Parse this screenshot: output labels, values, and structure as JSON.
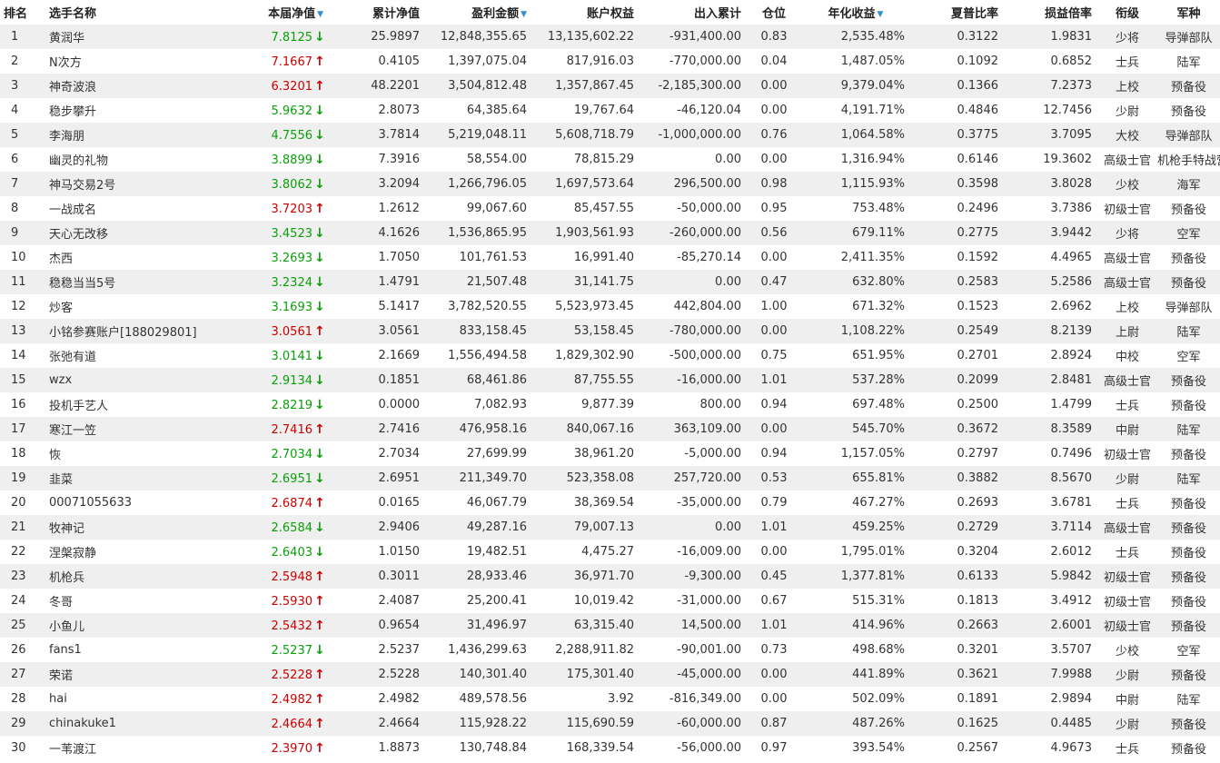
{
  "columns": {
    "rank": "排名",
    "name": "选手名称",
    "net_value": "本届净值",
    "cumulative_net": "累计净值",
    "profit": "盈利金额",
    "equity": "账户权益",
    "in_out": "出入累计",
    "position": "仓位",
    "annualized": "年化收益",
    "sharpe": "夏普比率",
    "pl_ratio": "损益倍率",
    "military_rank": "衔级",
    "branch": "军种"
  },
  "sort_icon": "triangle-down-icon",
  "colors": {
    "up": "#cc0000",
    "down": "#0aa00a",
    "sort_icon": "#2f8fd1",
    "row_alt": "#efefef"
  },
  "rows": [
    {
      "rank": "1",
      "name": "黄润华",
      "net": "7.8125",
      "dir": "down",
      "cum": "25.9897",
      "pnl": "12,848,355.65",
      "equity": "13,135,602.22",
      "io": "-931,400.00",
      "pos": "0.83",
      "ann": "2,535.48%",
      "sharpe": "0.3122",
      "ratio": "1.9831",
      "mrank": "少将",
      "branch": "导弹部队"
    },
    {
      "rank": "2",
      "name": "N次方",
      "net": "7.1667",
      "dir": "up",
      "cum": "0.4105",
      "pnl": "1,397,075.04",
      "equity": "817,916.03",
      "io": "-770,000.00",
      "pos": "0.04",
      "ann": "1,487.05%",
      "sharpe": "0.1092",
      "ratio": "0.6852",
      "mrank": "士兵",
      "branch": "陆军"
    },
    {
      "rank": "3",
      "name": "神奇波浪",
      "net": "6.3201",
      "dir": "up",
      "cum": "48.2201",
      "pnl": "3,504,812.48",
      "equity": "1,357,867.45",
      "io": "-2,185,300.00",
      "pos": "0.00",
      "ann": "9,379.04%",
      "sharpe": "0.1366",
      "ratio": "7.2373",
      "mrank": "上校",
      "branch": "预备役"
    },
    {
      "rank": "4",
      "name": "稳步攀升",
      "net": "5.9632",
      "dir": "down",
      "cum": "2.8073",
      "pnl": "64,385.64",
      "equity": "19,767.64",
      "io": "-46,120.04",
      "pos": "0.00",
      "ann": "4,191.71%",
      "sharpe": "0.4846",
      "ratio": "12.7456",
      "mrank": "少尉",
      "branch": "预备役"
    },
    {
      "rank": "5",
      "name": "李海朋",
      "net": "4.7556",
      "dir": "down",
      "cum": "3.7814",
      "pnl": "5,219,048.11",
      "equity": "5,608,718.79",
      "io": "-1,000,000.00",
      "pos": "0.76",
      "ann": "1,064.58%",
      "sharpe": "0.3775",
      "ratio": "3.7095",
      "mrank": "大校",
      "branch": "导弹部队"
    },
    {
      "rank": "6",
      "name": "幽灵的礼物",
      "net": "3.8899",
      "dir": "down",
      "cum": "7.3916",
      "pnl": "58,554.00",
      "equity": "78,815.29",
      "io": "0.00",
      "pos": "0.00",
      "ann": "1,316.94%",
      "sharpe": "0.6146",
      "ratio": "19.3602",
      "mrank": "高级士官",
      "branch": "机枪手特战营"
    },
    {
      "rank": "7",
      "name": "神马交易2号",
      "net": "3.8062",
      "dir": "down",
      "cum": "3.2094",
      "pnl": "1,266,796.05",
      "equity": "1,697,573.64",
      "io": "296,500.00",
      "pos": "0.98",
      "ann": "1,115.93%",
      "sharpe": "0.3598",
      "ratio": "3.8028",
      "mrank": "少校",
      "branch": "海军"
    },
    {
      "rank": "8",
      "name": "一战成名",
      "net": "3.7203",
      "dir": "up",
      "cum": "1.2612",
      "pnl": "99,067.60",
      "equity": "85,457.55",
      "io": "-50,000.00",
      "pos": "0.95",
      "ann": "753.48%",
      "sharpe": "0.2496",
      "ratio": "3.7386",
      "mrank": "初级士官",
      "branch": "预备役"
    },
    {
      "rank": "9",
      "name": "天心无改移",
      "net": "3.4523",
      "dir": "down",
      "cum": "4.1626",
      "pnl": "1,536,865.95",
      "equity": "1,903,561.93",
      "io": "-260,000.00",
      "pos": "0.56",
      "ann": "679.11%",
      "sharpe": "0.2775",
      "ratio": "3.9442",
      "mrank": "少将",
      "branch": "空军"
    },
    {
      "rank": "10",
      "name": "杰西",
      "net": "3.2693",
      "dir": "down",
      "cum": "1.7050",
      "pnl": "101,761.53",
      "equity": "16,991.40",
      "io": "-85,270.14",
      "pos": "0.00",
      "ann": "2,411.35%",
      "sharpe": "0.1592",
      "ratio": "4.4965",
      "mrank": "高级士官",
      "branch": "预备役"
    },
    {
      "rank": "11",
      "name": "稳稳当当5号",
      "net": "3.2324",
      "dir": "down",
      "cum": "1.4791",
      "pnl": "21,507.48",
      "equity": "31,141.75",
      "io": "0.00",
      "pos": "0.47",
      "ann": "632.80%",
      "sharpe": "0.2583",
      "ratio": "5.2586",
      "mrank": "高级士官",
      "branch": "预备役"
    },
    {
      "rank": "12",
      "name": "炒客",
      "net": "3.1693",
      "dir": "down",
      "cum": "5.1417",
      "pnl": "3,782,520.55",
      "equity": "5,523,973.45",
      "io": "442,804.00",
      "pos": "1.00",
      "ann": "671.32%",
      "sharpe": "0.1523",
      "ratio": "2.6962",
      "mrank": "上校",
      "branch": "导弹部队"
    },
    {
      "rank": "13",
      "name": "小铭参赛账户[188029801]",
      "net": "3.0561",
      "dir": "up",
      "cum": "3.0561",
      "pnl": "833,158.45",
      "equity": "53,158.45",
      "io": "-780,000.00",
      "pos": "0.00",
      "ann": "1,108.22%",
      "sharpe": "0.2549",
      "ratio": "8.2139",
      "mrank": "上尉",
      "branch": "陆军"
    },
    {
      "rank": "14",
      "name": "张弛有道",
      "net": "3.0141",
      "dir": "down",
      "cum": "2.1669",
      "pnl": "1,556,494.58",
      "equity": "1,829,302.90",
      "io": "-500,000.00",
      "pos": "0.75",
      "ann": "651.95%",
      "sharpe": "0.2701",
      "ratio": "2.8924",
      "mrank": "中校",
      "branch": "空军"
    },
    {
      "rank": "15",
      "name": "wzx",
      "net": "2.9134",
      "dir": "down",
      "cum": "0.1851",
      "pnl": "68,461.86",
      "equity": "87,755.55",
      "io": "-16,000.00",
      "pos": "1.01",
      "ann": "537.28%",
      "sharpe": "0.2099",
      "ratio": "2.8481",
      "mrank": "高级士官",
      "branch": "预备役"
    },
    {
      "rank": "16",
      "name": "投机手艺人",
      "net": "2.8219",
      "dir": "down",
      "cum": "0.0000",
      "pnl": "7,082.93",
      "equity": "9,877.39",
      "io": "800.00",
      "pos": "0.94",
      "ann": "697.48%",
      "sharpe": "0.2500",
      "ratio": "1.4799",
      "mrank": "士兵",
      "branch": "预备役"
    },
    {
      "rank": "17",
      "name": "寒江一笠",
      "net": "2.7416",
      "dir": "up",
      "cum": "2.7416",
      "pnl": "476,958.16",
      "equity": "840,067.16",
      "io": "363,109.00",
      "pos": "0.00",
      "ann": "545.70%",
      "sharpe": "0.3672",
      "ratio": "8.3589",
      "mrank": "中尉",
      "branch": "陆军"
    },
    {
      "rank": "18",
      "name": "恢",
      "net": "2.7034",
      "dir": "down",
      "cum": "2.7034",
      "pnl": "27,699.99",
      "equity": "38,961.20",
      "io": "-5,000.00",
      "pos": "0.94",
      "ann": "1,157.05%",
      "sharpe": "0.2797",
      "ratio": "0.7496",
      "mrank": "初级士官",
      "branch": "预备役"
    },
    {
      "rank": "19",
      "name": "韭菜",
      "net": "2.6951",
      "dir": "down",
      "cum": "2.6951",
      "pnl": "211,349.70",
      "equity": "523,358.08",
      "io": "257,720.00",
      "pos": "0.53",
      "ann": "655.81%",
      "sharpe": "0.3882",
      "ratio": "8.5670",
      "mrank": "少尉",
      "branch": "陆军"
    },
    {
      "rank": "20",
      "name": "00071055633",
      "net": "2.6874",
      "dir": "up",
      "cum": "0.0165",
      "pnl": "46,067.79",
      "equity": "38,369.54",
      "io": "-35,000.00",
      "pos": "0.79",
      "ann": "467.27%",
      "sharpe": "0.2693",
      "ratio": "3.6781",
      "mrank": "士兵",
      "branch": "预备役"
    },
    {
      "rank": "21",
      "name": "牧神记",
      "net": "2.6584",
      "dir": "down",
      "cum": "2.9406",
      "pnl": "49,287.16",
      "equity": "79,007.13",
      "io": "0.00",
      "pos": "1.01",
      "ann": "459.25%",
      "sharpe": "0.2729",
      "ratio": "3.7114",
      "mrank": "高级士官",
      "branch": "预备役"
    },
    {
      "rank": "22",
      "name": "涅槃寂静",
      "net": "2.6403",
      "dir": "down",
      "cum": "1.0150",
      "pnl": "19,482.51",
      "equity": "4,475.27",
      "io": "-16,009.00",
      "pos": "0.00",
      "ann": "1,795.01%",
      "sharpe": "0.3204",
      "ratio": "2.6012",
      "mrank": "士兵",
      "branch": "预备役"
    },
    {
      "rank": "23",
      "name": "机枪兵",
      "net": "2.5948",
      "dir": "up",
      "cum": "0.3011",
      "pnl": "28,933.46",
      "equity": "36,971.70",
      "io": "-9,300.00",
      "pos": "0.45",
      "ann": "1,377.81%",
      "sharpe": "0.6133",
      "ratio": "5.9842",
      "mrank": "初级士官",
      "branch": "预备役"
    },
    {
      "rank": "24",
      "name": "冬哥",
      "net": "2.5930",
      "dir": "up",
      "cum": "2.4087",
      "pnl": "25,200.41",
      "equity": "10,019.42",
      "io": "-31,000.00",
      "pos": "0.67",
      "ann": "515.31%",
      "sharpe": "0.1813",
      "ratio": "3.4912",
      "mrank": "初级士官",
      "branch": "预备役"
    },
    {
      "rank": "25",
      "name": "小鱼儿",
      "net": "2.5432",
      "dir": "up",
      "cum": "0.9654",
      "pnl": "31,496.97",
      "equity": "63,315.40",
      "io": "14,500.00",
      "pos": "1.01",
      "ann": "414.96%",
      "sharpe": "0.2663",
      "ratio": "2.6001",
      "mrank": "初级士官",
      "branch": "预备役"
    },
    {
      "rank": "26",
      "name": "fans1",
      "net": "2.5237",
      "dir": "down",
      "cum": "2.5237",
      "pnl": "1,436,299.63",
      "equity": "2,288,911.82",
      "io": "-90,001.00",
      "pos": "0.73",
      "ann": "498.68%",
      "sharpe": "0.3201",
      "ratio": "3.5707",
      "mrank": "少校",
      "branch": "空军"
    },
    {
      "rank": "27",
      "name": "荣诺",
      "net": "2.5228",
      "dir": "up",
      "cum": "2.5228",
      "pnl": "140,301.40",
      "equity": "175,301.40",
      "io": "-45,000.00",
      "pos": "0.00",
      "ann": "441.89%",
      "sharpe": "0.3621",
      "ratio": "7.9988",
      "mrank": "少尉",
      "branch": "预备役"
    },
    {
      "rank": "28",
      "name": "hai",
      "net": "2.4982",
      "dir": "up",
      "cum": "2.4982",
      "pnl": "489,578.56",
      "equity": "3.92",
      "io": "-816,349.00",
      "pos": "0.00",
      "ann": "502.09%",
      "sharpe": "0.1891",
      "ratio": "2.9894",
      "mrank": "中尉",
      "branch": "陆军"
    },
    {
      "rank": "29",
      "name": "chinakuke1",
      "net": "2.4664",
      "dir": "up",
      "cum": "2.4664",
      "pnl": "115,928.22",
      "equity": "115,690.59",
      "io": "-60,000.00",
      "pos": "0.87",
      "ann": "487.26%",
      "sharpe": "0.1625",
      "ratio": "0.4485",
      "mrank": "少尉",
      "branch": "预备役"
    },
    {
      "rank": "30",
      "name": "一苇渡江",
      "net": "2.3970",
      "dir": "up",
      "cum": "1.8873",
      "pnl": "130,748.84",
      "equity": "168,339.54",
      "io": "-56,000.00",
      "pos": "0.97",
      "ann": "393.54%",
      "sharpe": "0.2567",
      "ratio": "4.9673",
      "mrank": "士兵",
      "branch": "预备役"
    }
  ]
}
